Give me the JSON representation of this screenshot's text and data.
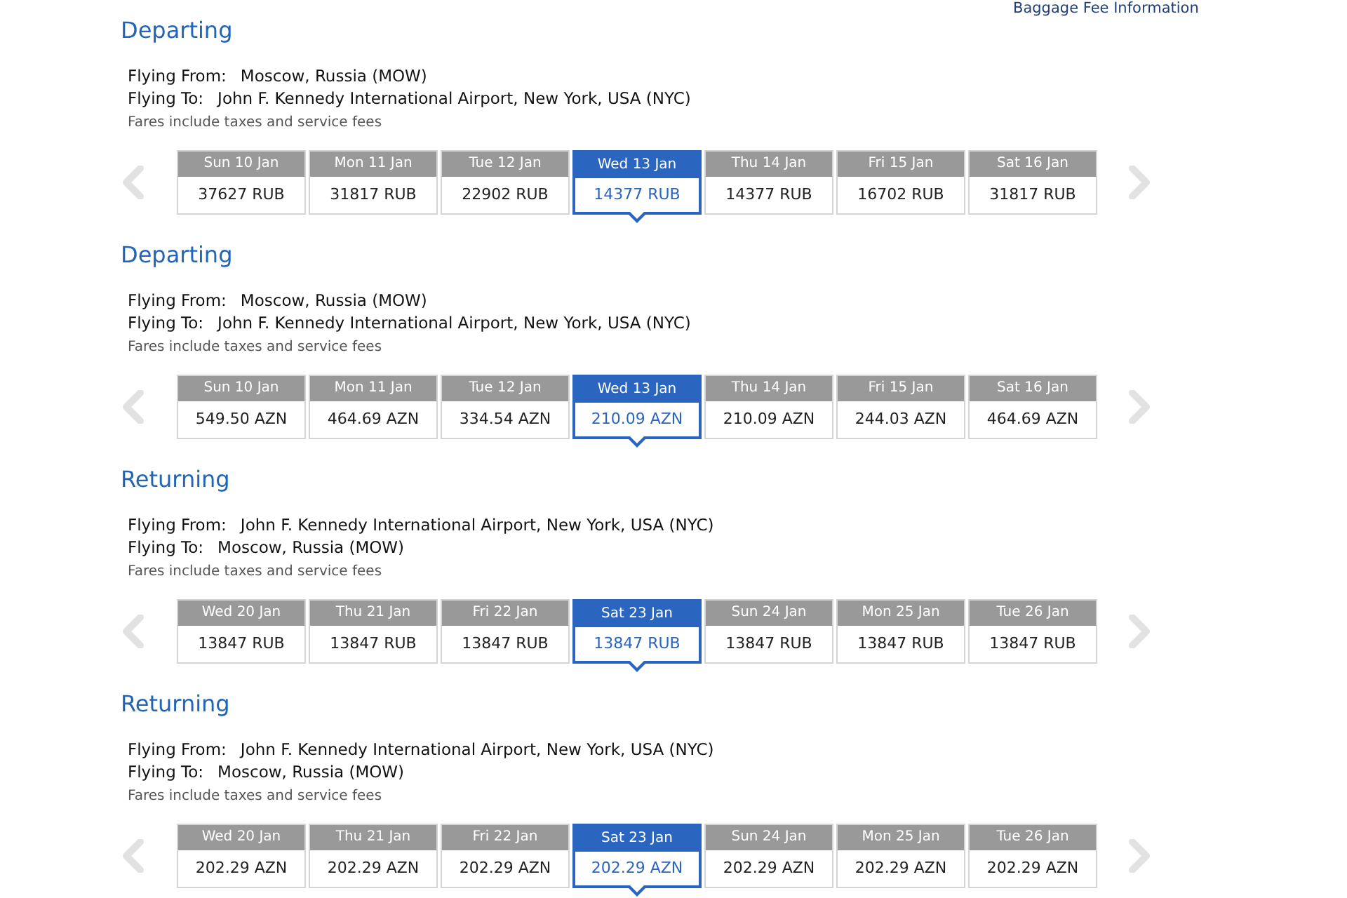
{
  "baggage_link": "Baggage Fee Information",
  "sections": [
    {
      "title": "Departing",
      "from_label": "Flying From:",
      "from": "Moscow, Russia (MOW)",
      "to_label": "Flying To:",
      "to": "John F. Kennedy International Airport, New York, USA (NYC)",
      "note": "Fares include taxes and service fees",
      "days": [
        {
          "date": "Sun 10 Jan",
          "price": "37627 RUB",
          "selected": false
        },
        {
          "date": "Mon 11 Jan",
          "price": "31817 RUB",
          "selected": false
        },
        {
          "date": "Tue 12 Jan",
          "price": "22902 RUB",
          "selected": false
        },
        {
          "date": "Wed 13 Jan",
          "price": "14377 RUB",
          "selected": true
        },
        {
          "date": "Thu 14 Jan",
          "price": "14377 RUB",
          "selected": false
        },
        {
          "date": "Fri 15 Jan",
          "price": "16702 RUB",
          "selected": false
        },
        {
          "date": "Sat 16 Jan",
          "price": "31817 RUB",
          "selected": false
        }
      ]
    },
    {
      "title": "Departing",
      "from_label": "Flying From:",
      "from": "Moscow, Russia (MOW)",
      "to_label": "Flying To:",
      "to": "John F. Kennedy International Airport, New York, USA (NYC)",
      "note": "Fares include taxes and service fees",
      "days": [
        {
          "date": "Sun 10 Jan",
          "price": "549.50 AZN",
          "selected": false
        },
        {
          "date": "Mon 11 Jan",
          "price": "464.69 AZN",
          "selected": false
        },
        {
          "date": "Tue 12 Jan",
          "price": "334.54 AZN",
          "selected": false
        },
        {
          "date": "Wed 13 Jan",
          "price": "210.09 AZN",
          "selected": true
        },
        {
          "date": "Thu 14 Jan",
          "price": "210.09 AZN",
          "selected": false
        },
        {
          "date": "Fri 15 Jan",
          "price": "244.03 AZN",
          "selected": false
        },
        {
          "date": "Sat 16 Jan",
          "price": "464.69 AZN",
          "selected": false
        }
      ]
    },
    {
      "title": "Returning",
      "from_label": "Flying From:",
      "from": "John F. Kennedy International Airport, New York, USA (NYC)",
      "to_label": "Flying To:",
      "to": "Moscow, Russia (MOW)",
      "note": "Fares include taxes and service fees",
      "days": [
        {
          "date": "Wed 20 Jan",
          "price": "13847 RUB",
          "selected": false
        },
        {
          "date": "Thu 21 Jan",
          "price": "13847 RUB",
          "selected": false
        },
        {
          "date": "Fri 22 Jan",
          "price": "13847 RUB",
          "selected": false
        },
        {
          "date": "Sat 23 Jan",
          "price": "13847 RUB",
          "selected": true
        },
        {
          "date": "Sun 24 Jan",
          "price": "13847 RUB",
          "selected": false
        },
        {
          "date": "Mon 25 Jan",
          "price": "13847 RUB",
          "selected": false
        },
        {
          "date": "Tue 26 Jan",
          "price": "13847 RUB",
          "selected": false
        }
      ]
    },
    {
      "title": "Returning",
      "from_label": "Flying From:",
      "from": "John F. Kennedy International Airport, New York, USA (NYC)",
      "to_label": "Flying To:",
      "to": "Moscow, Russia (MOW)",
      "note": "Fares include taxes and service fees",
      "days": [
        {
          "date": "Wed 20 Jan",
          "price": "202.29 AZN",
          "selected": false
        },
        {
          "date": "Thu 21 Jan",
          "price": "202.29 AZN",
          "selected": false
        },
        {
          "date": "Fri 22 Jan",
          "price": "202.29 AZN",
          "selected": false
        },
        {
          "date": "Sat 23 Jan",
          "price": "202.29 AZN",
          "selected": true
        },
        {
          "date": "Sun 24 Jan",
          "price": "202.29 AZN",
          "selected": false
        },
        {
          "date": "Mon 25 Jan",
          "price": "202.29 AZN",
          "selected": false
        },
        {
          "date": "Tue 26 Jan",
          "price": "202.29 AZN",
          "selected": false
        }
      ]
    }
  ]
}
